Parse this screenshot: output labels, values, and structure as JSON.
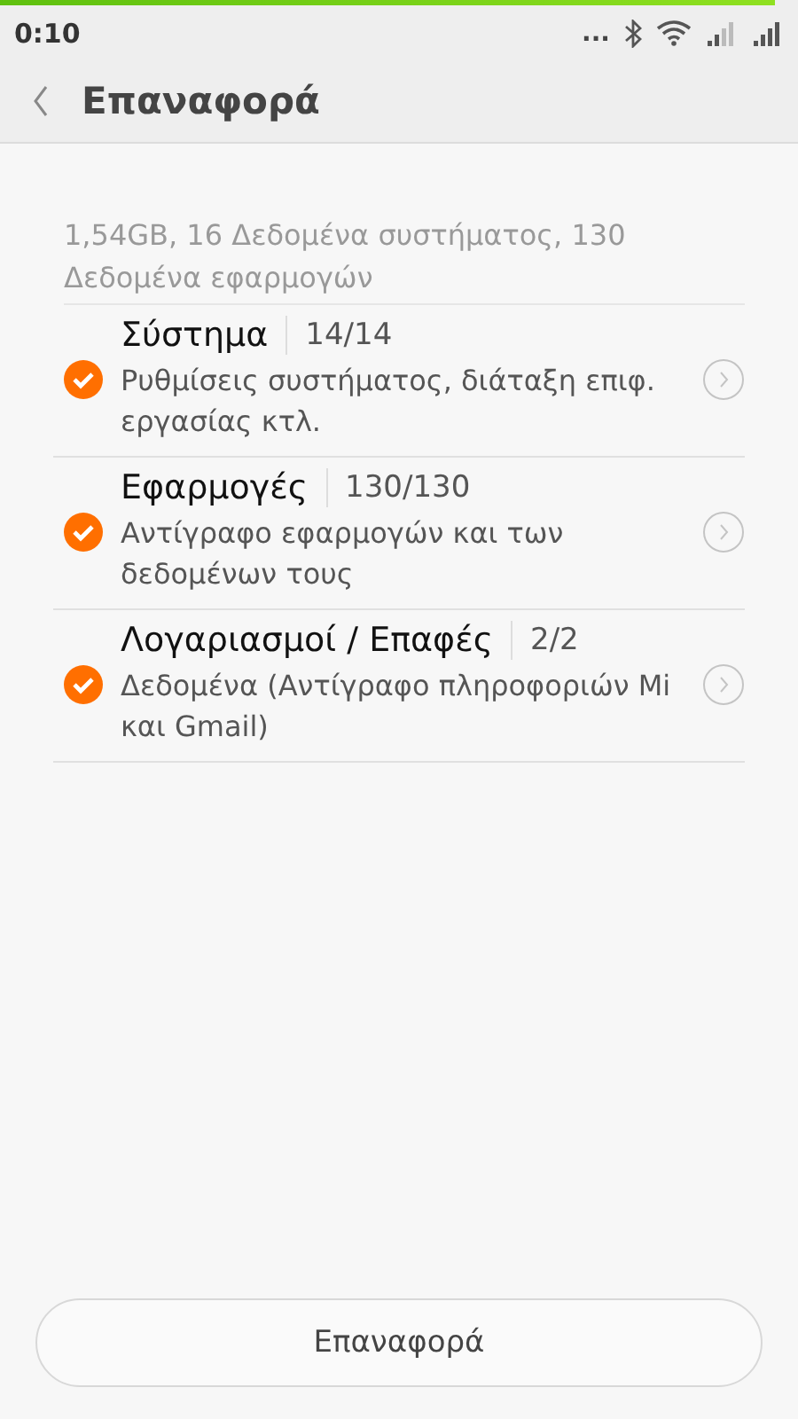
{
  "progress": {
    "level": 0.97
  },
  "status_bar": {
    "time": "0:10",
    "dots": "..."
  },
  "header": {
    "title": "Επαναφορά"
  },
  "summary": "1,54GB, 16  Δεδομένα συστήματος, 130 Δεδομένα εφαρμογών",
  "items": [
    {
      "title": "Σύστημα",
      "count": "14/14",
      "description": "Ρυθμίσεις συστήματος, διάταξη επιφ. εργασίας κτλ.",
      "checked": true
    },
    {
      "title": "Εφαρμογές",
      "count": "130/130",
      "description": "Αντίγραφο εφαρμογών και των δεδομένων τους",
      "checked": true
    },
    {
      "title": "Λογαριασμοί / Επαφές",
      "count": "2/2",
      "description": "Δεδομένα (Αντίγραφο πληροφοριών Mi και Gmail)",
      "checked": true
    }
  ],
  "button": {
    "label": "Επαναφορά"
  }
}
